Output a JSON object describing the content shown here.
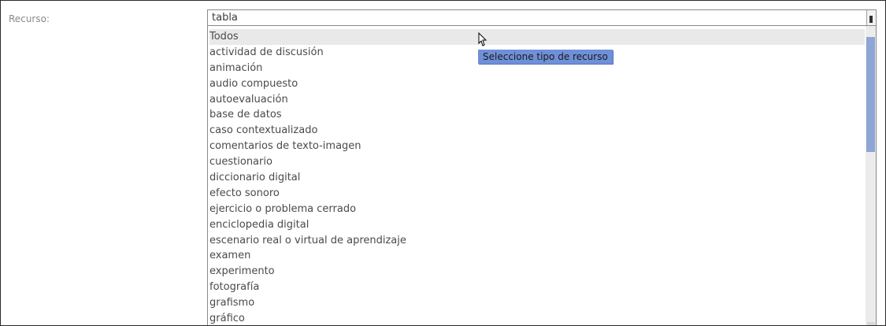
{
  "field": {
    "label": "Recurso:",
    "selected_value": "tabla"
  },
  "dropdown": {
    "options": [
      {
        "label": "Todos"
      },
      {
        "label": "actividad de discusión"
      },
      {
        "label": "animación"
      },
      {
        "label": "audio compuesto"
      },
      {
        "label": "autoevaluación"
      },
      {
        "label": "base de datos"
      },
      {
        "label": "caso contextualizado"
      },
      {
        "label": "comentarios de texto-imagen"
      },
      {
        "label": "cuestionario"
      },
      {
        "label": "diccionario digital"
      },
      {
        "label": "efecto sonoro"
      },
      {
        "label": "ejercicio o problema cerrado"
      },
      {
        "label": "enciclopedia digital"
      },
      {
        "label": "escenario real o virtual de aprendizaje"
      },
      {
        "label": "examen"
      },
      {
        "label": "experimento"
      },
      {
        "label": "fotografía"
      },
      {
        "label": "grafismo"
      },
      {
        "label": "gráfico"
      }
    ],
    "hovered_index": 0
  },
  "tooltip": {
    "text": "Seleccione tipo de recurso"
  },
  "icons": {
    "cursor": "mouse-pointer-icon",
    "dropdown_arrow": "dropdown-arrow-icon"
  },
  "colors": {
    "tooltip_bg": "#6f90d8",
    "scroll_thumb": "#8ea6d6",
    "hover_bg": "#e9e9e9"
  }
}
